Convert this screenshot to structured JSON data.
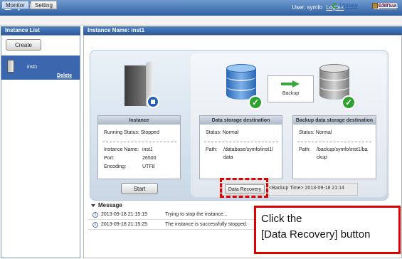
{
  "header": {
    "brand": "Symfoware",
    "user": "User: symfo",
    "logout": "Logout",
    "vendor_logo": "FUJITSU"
  },
  "tabs": [
    {
      "label": "Monitor",
      "active": true
    },
    {
      "label": "Setting",
      "active": false
    }
  ],
  "toolbar": {
    "update": "Update",
    "manual": "Manual"
  },
  "instance_list": {
    "title": "Instance List",
    "create_label": "Create",
    "items": [
      {
        "name": "inst1",
        "delete_label": "Delete"
      }
    ]
  },
  "main": {
    "title": "Instance Name: inst1",
    "instance_card": {
      "title": "Instance",
      "running_status": "Running Status: Stopped",
      "name_label": "Instance Name:",
      "name_value": "inst1",
      "port_label": "Port:",
      "port_value": "26500",
      "encoding_label": "Encoding:",
      "encoding_value": "UTF8"
    },
    "data_storage": {
      "title": "Data storage destination",
      "status": "Status: Normal",
      "path_label": "Path:",
      "path_line1": "/database/symfo/inst1/",
      "path_line2": "data"
    },
    "backup_storage": {
      "title": "Backup data storage destination",
      "status": "Status: Normal",
      "path_label": "Path:",
      "path_line1": "/backup/symfo/inst1/ba",
      "path_line2": "ckup"
    },
    "backup_button": "Backup",
    "start_button": "Start",
    "data_recovery_button": "Data Recovery",
    "backup_time": "<Backup Time> 2013-09-18 21:14"
  },
  "messages": {
    "title": "Message",
    "rows": [
      {
        "time": "2013-09-18 21:15:15",
        "text": "Trying to stop the instance..."
      },
      {
        "time": "2013-09-18 21:15:25",
        "text": "The instance is successfully stopped."
      }
    ]
  },
  "callout": {
    "line1": "Click the",
    "line2": "[Data Recovery]  button"
  },
  "colors": {
    "header_blue": "#2f5f9f",
    "selected_item": "#3a67ad",
    "ok_green": "#2fa12f",
    "highlight_red": "#e00000"
  }
}
